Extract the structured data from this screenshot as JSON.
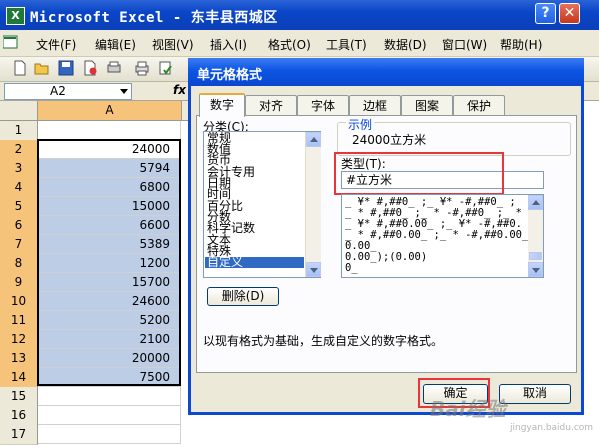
{
  "window": {
    "title": "Microsoft Excel - 东丰县西城区",
    "app_icon": "excel-icon"
  },
  "menu": {
    "items": [
      "文件(F)",
      "编辑(E)",
      "视图(V)",
      "插入(I)",
      "格式(O)",
      "工具(T)",
      "数据(D)",
      "窗口(W)",
      "帮助(H)"
    ]
  },
  "toolbar": {
    "icons": [
      "new-icon",
      "open-icon",
      "save-icon",
      "permission-icon",
      "print-preview-icon",
      "print-icon",
      "spellcheck-icon"
    ]
  },
  "formula_bar": {
    "name_box": "A2",
    "fx": "fx"
  },
  "sheet": {
    "column_header": "A",
    "rows": [
      {
        "row": "1",
        "value": ""
      },
      {
        "row": "2",
        "value": "24000"
      },
      {
        "row": "3",
        "value": "5794"
      },
      {
        "row": "4",
        "value": "6800"
      },
      {
        "row": "5",
        "value": "15000"
      },
      {
        "row": "6",
        "value": "6600"
      },
      {
        "row": "7",
        "value": "5389"
      },
      {
        "row": "8",
        "value": "1200"
      },
      {
        "row": "9",
        "value": "15700"
      },
      {
        "row": "10",
        "value": "24600"
      },
      {
        "row": "11",
        "value": "5200"
      },
      {
        "row": "12",
        "value": "2100"
      },
      {
        "row": "13",
        "value": "20000"
      },
      {
        "row": "14",
        "value": "7500"
      },
      {
        "row": "15",
        "value": ""
      },
      {
        "row": "16",
        "value": ""
      },
      {
        "row": "17",
        "value": ""
      }
    ]
  },
  "dialog": {
    "title": "单元格格式",
    "help": "?",
    "close": "✕",
    "tabs": [
      "数字",
      "对齐",
      "字体",
      "边框",
      "图案",
      "保护"
    ],
    "active_tab": "数字",
    "category_label": "分类(C):",
    "categories": [
      "常规",
      "数值",
      "货币",
      "会计专用",
      "日期",
      "时间",
      "百分比",
      "分数",
      "科学记数",
      "文本",
      "特殊",
      "自定义"
    ],
    "selected_category": "自定义",
    "sample_label": "示例",
    "sample_value": "24000立方米",
    "type_label": "类型(T):",
    "type_value": "#立方米",
    "formats": [
      "_ ¥* #,##0_ ;_ ¥* -#,##0_ ;",
      "_ * #,##0_ ;_ * -#,##0_ ;_ *",
      "_ ¥* #,##0.00_ ;_ ¥* -#,##0.",
      "_ * #,##0.00_ ;_ * -#,##0.00_",
      "0.00_",
      "0.00_);(0.00)",
      "0_"
    ],
    "delete_button": "删除(D)",
    "hint": "以现有格式为基础，生成自定义的数字格式。",
    "ok_button": "确定",
    "cancel_button": "取消"
  },
  "watermark": {
    "text": "Bai经验",
    "sub": "jingyan.baidu.com"
  }
}
